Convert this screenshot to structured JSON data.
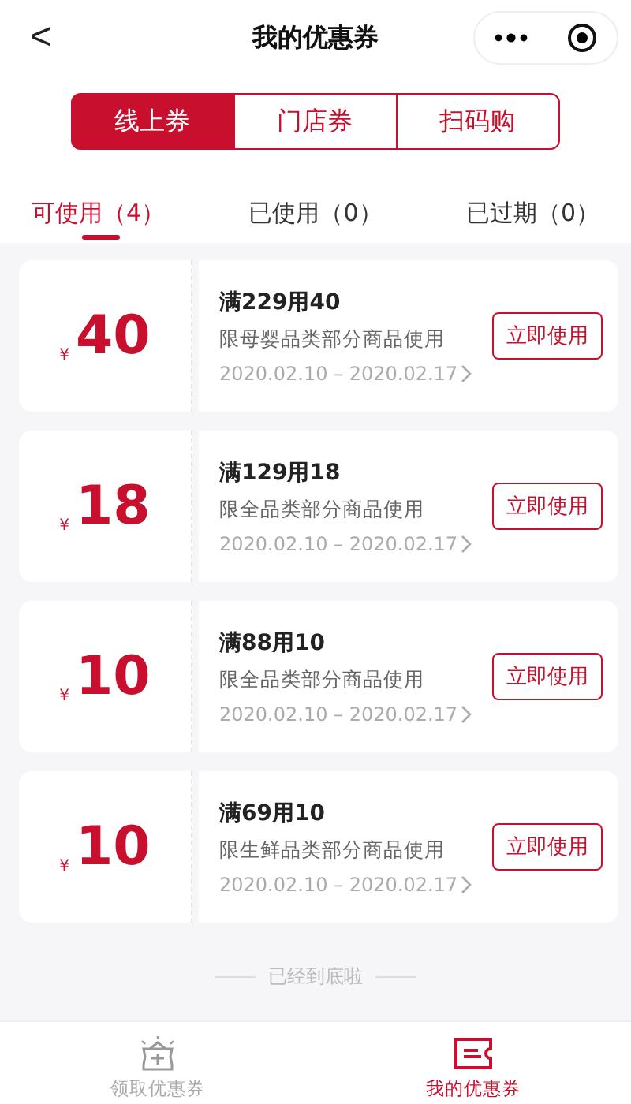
{
  "header": {
    "back": "<",
    "title": "我的优惠券"
  },
  "segments": [
    {
      "label": "线上券",
      "selected": true
    },
    {
      "label": "门店券",
      "selected": false
    },
    {
      "label": "扫码购",
      "selected": false
    }
  ],
  "tabs": [
    {
      "label": "可使用（4）",
      "selected": true
    },
    {
      "label": "已使用（0）",
      "selected": false
    },
    {
      "label": "已过期（0）",
      "selected": false
    }
  ],
  "coupons": [
    {
      "currency": "¥",
      "amount": "40",
      "title": "满229用40",
      "scope": "限母婴品类部分商品使用",
      "period": "2020.02.10 – 2020.02.17",
      "button": "立即使用"
    },
    {
      "currency": "¥",
      "amount": "18",
      "title": "满129用18",
      "scope": "限全品类部分商品使用",
      "period": "2020.02.10 – 2020.02.17",
      "button": "立即使用"
    },
    {
      "currency": "¥",
      "amount": "10",
      "title": "满88用10",
      "scope": "限全品类部分商品使用",
      "period": "2020.02.10 – 2020.02.17",
      "button": "立即使用"
    },
    {
      "currency": "¥",
      "amount": "10",
      "title": "满69用10",
      "scope": "限生鲜品类部分商品使用",
      "period": "2020.02.10 – 2020.02.17",
      "button": "立即使用"
    }
  ],
  "end_note": "已经到底啦",
  "bottom_nav": [
    {
      "kind": "wallet",
      "label": "领取优惠券",
      "selected": false
    },
    {
      "kind": "ticket",
      "label": "我的优惠券",
      "selected": true
    }
  ]
}
